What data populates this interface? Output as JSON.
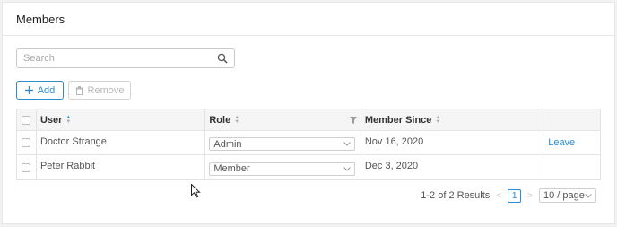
{
  "card": {
    "title": "Members"
  },
  "search": {
    "placeholder": "Search",
    "value": "",
    "icon": "search-icon"
  },
  "toolbar": {
    "add_label": "Add",
    "remove_label": "Remove"
  },
  "table": {
    "columns": {
      "user": "User",
      "role": "Role",
      "member_since": "Member Since"
    },
    "rows": [
      {
        "user": "Doctor Strange",
        "role": "Admin",
        "member_since": "Nov 16, 2020",
        "action": "Leave"
      },
      {
        "user": "Peter Rabbit",
        "role": "Member",
        "member_since": "Dec 3, 2020",
        "action": ""
      }
    ]
  },
  "pagination": {
    "results": "1-2 of 2 Results",
    "current_page": "1",
    "page_size": "10 / page"
  },
  "colors": {
    "accent": "#2d8ccf",
    "border": "#e3e3e3",
    "header_bg": "#f5f5f5"
  }
}
